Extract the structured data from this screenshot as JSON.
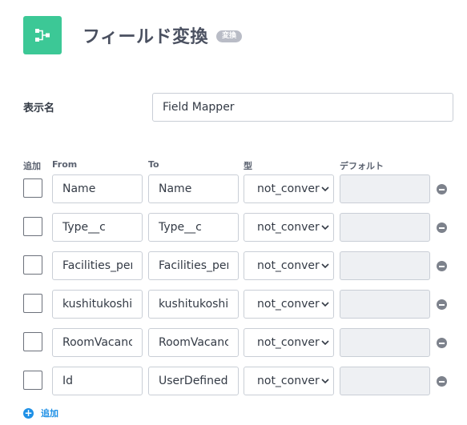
{
  "header": {
    "title": "フィールド変換",
    "badge": "変換",
    "icon": "node-branch-icon",
    "icon_color": "#3cc896"
  },
  "display_name": {
    "label": "表示名",
    "value": "Field Mapper"
  },
  "columns": {
    "add": "追加",
    "from": "From",
    "to": "To",
    "type": "型",
    "default": "デフォルト"
  },
  "rows": [
    {
      "from": "Name",
      "to": "Name",
      "type": "not_convert",
      "default": ""
    },
    {
      "from": "Type__c",
      "to": "Type__c",
      "type": "not_convert",
      "default": ""
    },
    {
      "from": "Facilities_personal__c",
      "to": "Facilities_personal__c",
      "type": "not_convert",
      "default": ""
    },
    {
      "from": "kushitukoshin__c",
      "to": "kushitukoshin__c",
      "type": "not_convert",
      "default": ""
    },
    {
      "from": "RoomVacancy__c",
      "to": "RoomVacancy__c",
      "type": "not_convert",
      "default": ""
    },
    {
      "from": "Id",
      "to": "UserDefinedId",
      "type": "not_convert",
      "default": ""
    }
  ],
  "add_button": {
    "label": "追加",
    "color": "#1e90e6"
  }
}
